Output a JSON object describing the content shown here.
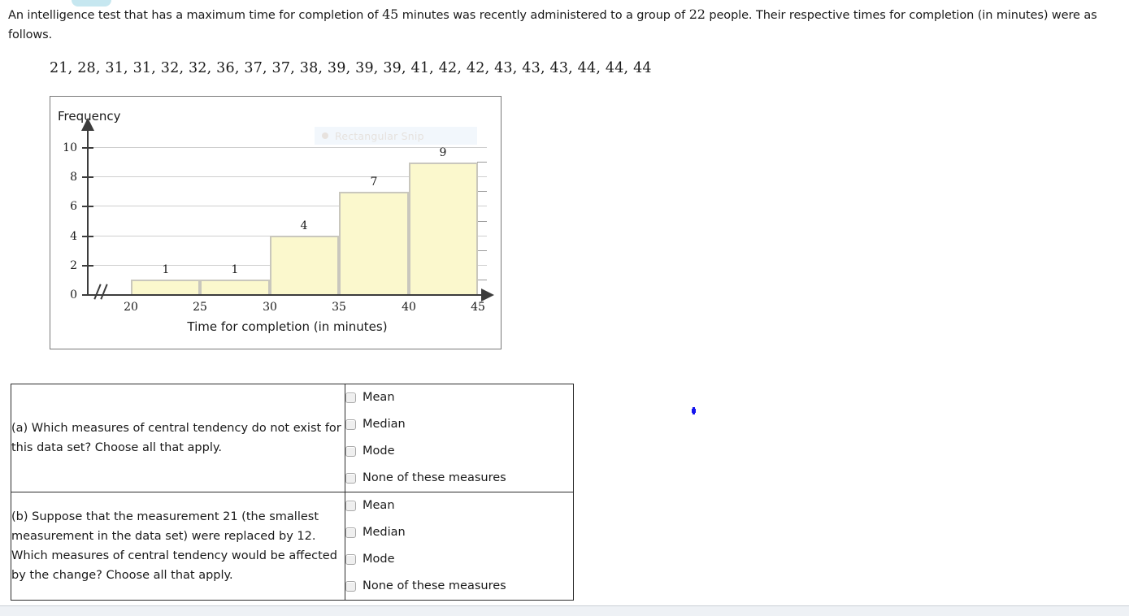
{
  "problem": {
    "statement_part1": "An intelligence test that has a maximum time for completion of ",
    "max_time": "45",
    "statement_part2": " minutes was recently administered to a group of ",
    "group_size": "22",
    "statement_part3": " people. Their respective times for completion (in minutes) were as follows.",
    "data_list": "21, 28, 31, 31, 32, 32, 36, 37, 37, 38, 39, 39, 39, 41, 42, 42, 43, 43, 43, 44, 44, 44"
  },
  "snip_tooltip": {
    "label": "Rectangular Snip"
  },
  "chart_data": {
    "type": "bar",
    "title": "",
    "ylabel": "Frequency",
    "xlabel": "Time for completion (in minutes)",
    "categories": [
      "20-25",
      "25-30",
      "30-35",
      "35-40",
      "40-45"
    ],
    "bin_edges": [
      20,
      25,
      30,
      35,
      40,
      45
    ],
    "values": [
      1,
      1,
      4,
      7,
      9
    ],
    "bar_labels": [
      "1",
      "1",
      "4",
      "7",
      "9"
    ],
    "x_ticks": [
      "20",
      "25",
      "30",
      "35",
      "40",
      "45"
    ],
    "y_ticks": [
      "0",
      "2",
      "4",
      "6",
      "8",
      "10"
    ],
    "ylim": [
      0,
      11
    ],
    "xlim": [
      20,
      45
    ],
    "grid": true,
    "legend": "none",
    "axis_break": true,
    "bar_fill": "#fbf8cd",
    "bar_border": "#c9c7bd"
  },
  "questions": [
    {
      "prompt": "(a) Which measures of central tendency do not exist for this data set? Choose all that apply.",
      "options": [
        "Mean",
        "Median",
        "Mode",
        "None of these measures"
      ]
    },
    {
      "prompt": "(b) Suppose that the measurement 21 (the smallest measurement in the data set) were replaced by 12. Which measures of central tendency would be affected by the change? Choose all that apply.",
      "options": [
        "Mean",
        "Median",
        "Mode",
        "None of these measures"
      ]
    }
  ]
}
